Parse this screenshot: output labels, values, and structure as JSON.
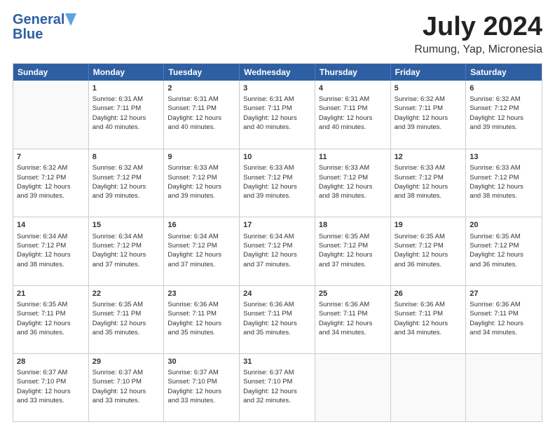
{
  "header": {
    "logo_line1": "General",
    "logo_line2": "Blue",
    "month": "July 2024",
    "location": "Rumung, Yap, Micronesia"
  },
  "calendar": {
    "days": [
      "Sunday",
      "Monday",
      "Tuesday",
      "Wednesday",
      "Thursday",
      "Friday",
      "Saturday"
    ],
    "rows": [
      [
        {
          "num": "",
          "text": "",
          "empty": true
        },
        {
          "num": "1",
          "text": "Sunrise: 6:31 AM\nSunset: 7:11 PM\nDaylight: 12 hours\nand 40 minutes."
        },
        {
          "num": "2",
          "text": "Sunrise: 6:31 AM\nSunset: 7:11 PM\nDaylight: 12 hours\nand 40 minutes."
        },
        {
          "num": "3",
          "text": "Sunrise: 6:31 AM\nSunset: 7:11 PM\nDaylight: 12 hours\nand 40 minutes."
        },
        {
          "num": "4",
          "text": "Sunrise: 6:31 AM\nSunset: 7:11 PM\nDaylight: 12 hours\nand 40 minutes."
        },
        {
          "num": "5",
          "text": "Sunrise: 6:32 AM\nSunset: 7:11 PM\nDaylight: 12 hours\nand 39 minutes."
        },
        {
          "num": "6",
          "text": "Sunrise: 6:32 AM\nSunset: 7:12 PM\nDaylight: 12 hours\nand 39 minutes."
        }
      ],
      [
        {
          "num": "7",
          "text": "Sunrise: 6:32 AM\nSunset: 7:12 PM\nDaylight: 12 hours\nand 39 minutes."
        },
        {
          "num": "8",
          "text": "Sunrise: 6:32 AM\nSunset: 7:12 PM\nDaylight: 12 hours\nand 39 minutes."
        },
        {
          "num": "9",
          "text": "Sunrise: 6:33 AM\nSunset: 7:12 PM\nDaylight: 12 hours\nand 39 minutes."
        },
        {
          "num": "10",
          "text": "Sunrise: 6:33 AM\nSunset: 7:12 PM\nDaylight: 12 hours\nand 39 minutes."
        },
        {
          "num": "11",
          "text": "Sunrise: 6:33 AM\nSunset: 7:12 PM\nDaylight: 12 hours\nand 38 minutes."
        },
        {
          "num": "12",
          "text": "Sunrise: 6:33 AM\nSunset: 7:12 PM\nDaylight: 12 hours\nand 38 minutes."
        },
        {
          "num": "13",
          "text": "Sunrise: 6:33 AM\nSunset: 7:12 PM\nDaylight: 12 hours\nand 38 minutes."
        }
      ],
      [
        {
          "num": "14",
          "text": "Sunrise: 6:34 AM\nSunset: 7:12 PM\nDaylight: 12 hours\nand 38 minutes."
        },
        {
          "num": "15",
          "text": "Sunrise: 6:34 AM\nSunset: 7:12 PM\nDaylight: 12 hours\nand 37 minutes."
        },
        {
          "num": "16",
          "text": "Sunrise: 6:34 AM\nSunset: 7:12 PM\nDaylight: 12 hours\nand 37 minutes."
        },
        {
          "num": "17",
          "text": "Sunrise: 6:34 AM\nSunset: 7:12 PM\nDaylight: 12 hours\nand 37 minutes."
        },
        {
          "num": "18",
          "text": "Sunrise: 6:35 AM\nSunset: 7:12 PM\nDaylight: 12 hours\nand 37 minutes."
        },
        {
          "num": "19",
          "text": "Sunrise: 6:35 AM\nSunset: 7:12 PM\nDaylight: 12 hours\nand 36 minutes."
        },
        {
          "num": "20",
          "text": "Sunrise: 6:35 AM\nSunset: 7:12 PM\nDaylight: 12 hours\nand 36 minutes."
        }
      ],
      [
        {
          "num": "21",
          "text": "Sunrise: 6:35 AM\nSunset: 7:11 PM\nDaylight: 12 hours\nand 36 minutes."
        },
        {
          "num": "22",
          "text": "Sunrise: 6:35 AM\nSunset: 7:11 PM\nDaylight: 12 hours\nand 35 minutes."
        },
        {
          "num": "23",
          "text": "Sunrise: 6:36 AM\nSunset: 7:11 PM\nDaylight: 12 hours\nand 35 minutes."
        },
        {
          "num": "24",
          "text": "Sunrise: 6:36 AM\nSunset: 7:11 PM\nDaylight: 12 hours\nand 35 minutes."
        },
        {
          "num": "25",
          "text": "Sunrise: 6:36 AM\nSunset: 7:11 PM\nDaylight: 12 hours\nand 34 minutes."
        },
        {
          "num": "26",
          "text": "Sunrise: 6:36 AM\nSunset: 7:11 PM\nDaylight: 12 hours\nand 34 minutes."
        },
        {
          "num": "27",
          "text": "Sunrise: 6:36 AM\nSunset: 7:11 PM\nDaylight: 12 hours\nand 34 minutes."
        }
      ],
      [
        {
          "num": "28",
          "text": "Sunrise: 6:37 AM\nSunset: 7:10 PM\nDaylight: 12 hours\nand 33 minutes."
        },
        {
          "num": "29",
          "text": "Sunrise: 6:37 AM\nSunset: 7:10 PM\nDaylight: 12 hours\nand 33 minutes."
        },
        {
          "num": "30",
          "text": "Sunrise: 6:37 AM\nSunset: 7:10 PM\nDaylight: 12 hours\nand 33 minutes."
        },
        {
          "num": "31",
          "text": "Sunrise: 6:37 AM\nSunset: 7:10 PM\nDaylight: 12 hours\nand 32 minutes."
        },
        {
          "num": "",
          "text": "",
          "empty": true
        },
        {
          "num": "",
          "text": "",
          "empty": true
        },
        {
          "num": "",
          "text": "",
          "empty": true
        }
      ]
    ]
  }
}
